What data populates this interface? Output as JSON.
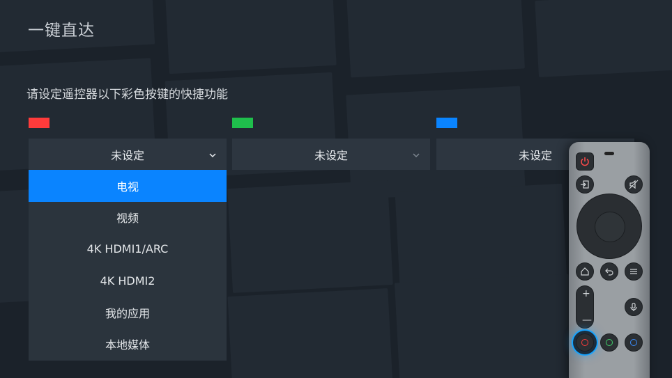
{
  "page": {
    "title": "一键直达",
    "subtitle": "请设定遥控器以下彩色按键的快捷功能"
  },
  "keys": [
    {
      "color": "#ff3b3b",
      "selected": "未设定",
      "expanded": true
    },
    {
      "color": "#1fbf4c",
      "selected": "未设定",
      "expanded": false
    },
    {
      "color": "#0a84ff",
      "selected": "未设定",
      "expanded": false
    }
  ],
  "dropdown": {
    "items": [
      "电视",
      "视频",
      "4K HDMI1/ARC",
      "4K HDMI2",
      "我的应用",
      "本地媒体"
    ],
    "highlighted_index": 0
  },
  "remote": {
    "icons": [
      "power-icon",
      "input-icon",
      "mute-icon",
      "home-icon",
      "back-icon",
      "menu-icon",
      "mic-icon"
    ],
    "volume_plus": "+",
    "volume_minus": "—",
    "highlighted_key": "red"
  }
}
